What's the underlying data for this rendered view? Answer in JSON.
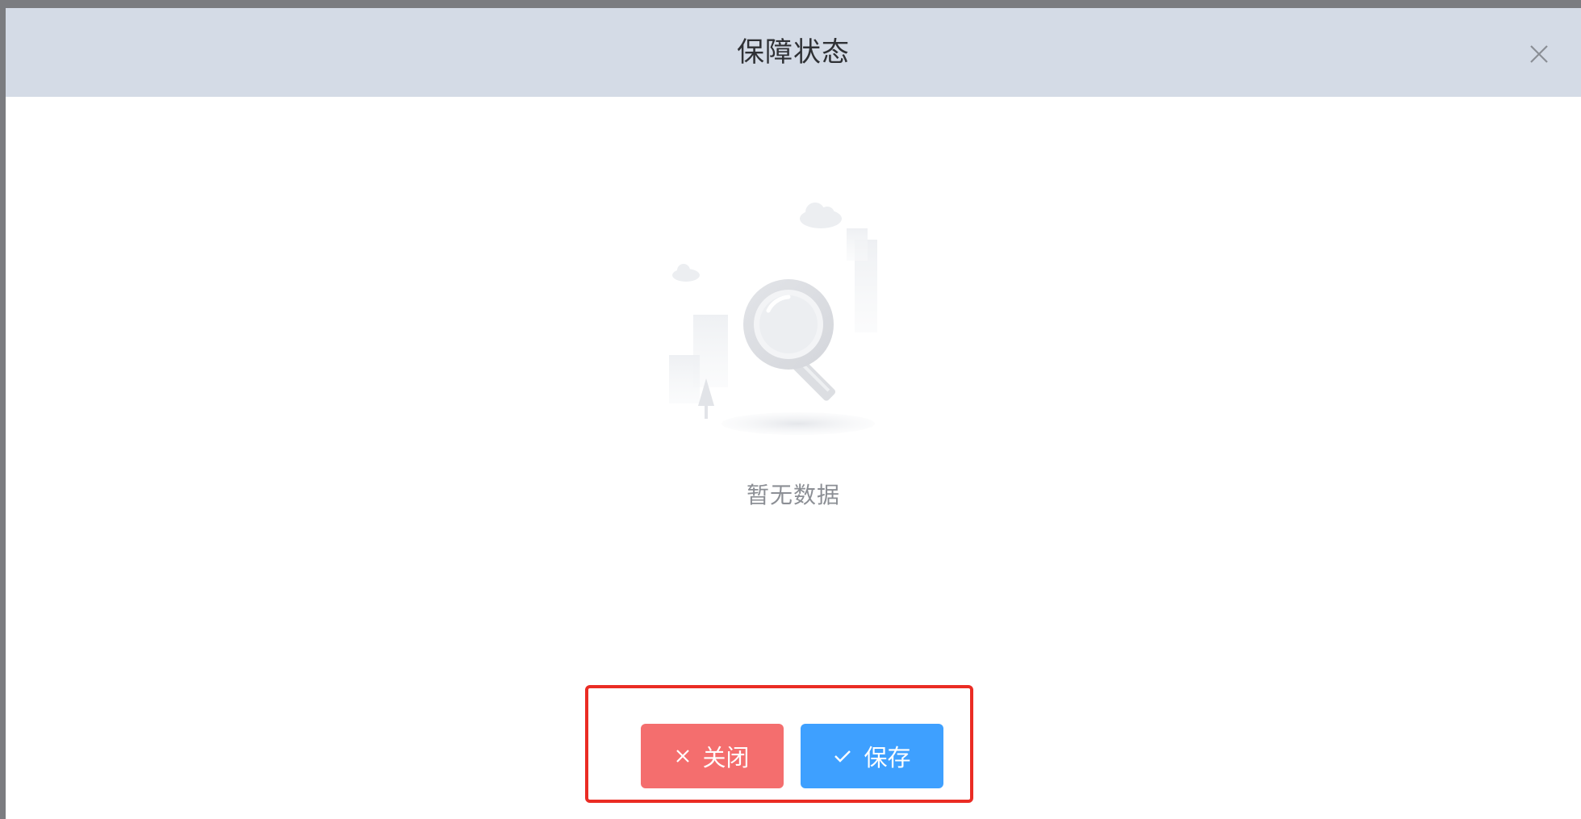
{
  "dialog": {
    "title": "保障状态",
    "close_icon": "close-icon"
  },
  "empty_state": {
    "illustration": "empty-search-illustration",
    "text": "暂无数据"
  },
  "footer": {
    "close_label": "关闭",
    "close_icon": "close-icon",
    "save_label": "保存",
    "save_icon": "check-icon"
  },
  "colors": {
    "header_bg": "#d4dbe6",
    "close_button": "#f46e6e",
    "save_button": "#3ea0ff",
    "highlight_border": "#ea2c24"
  }
}
